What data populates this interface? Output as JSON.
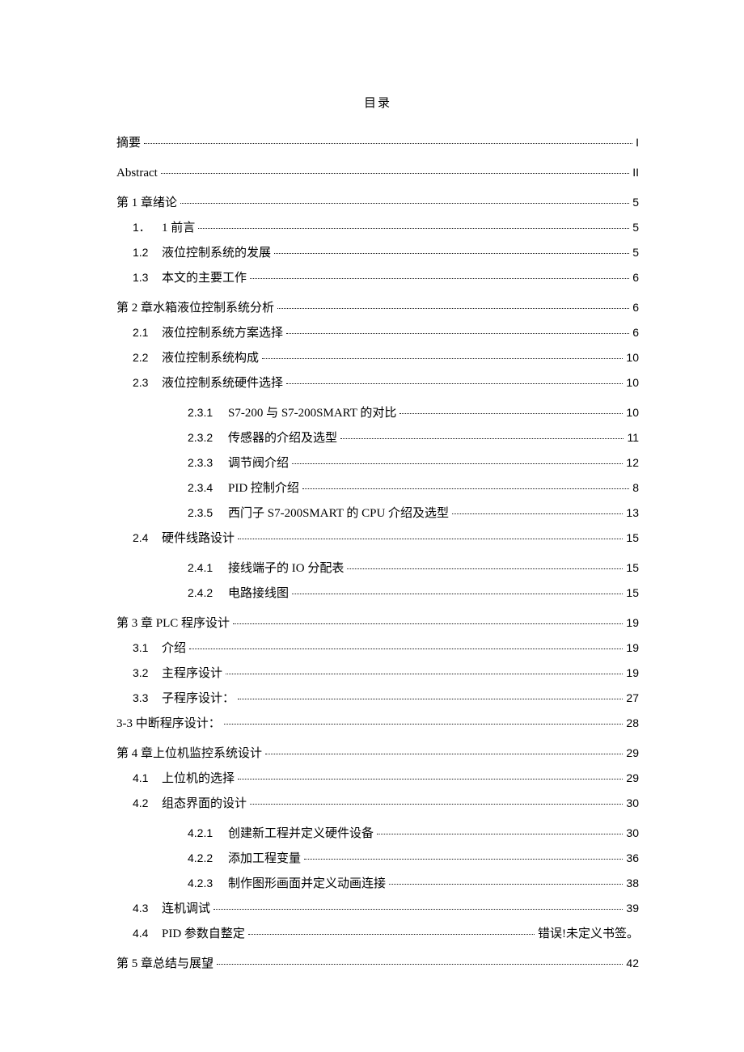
{
  "title": "目录",
  "error_text": "错误!未定义书签。",
  "entries": [
    {
      "level": 0,
      "num": "",
      "text": "摘要",
      "page": "I",
      "spacer": false
    },
    {
      "level": 0,
      "num": "",
      "text": "Abstract",
      "page": "II",
      "spacer": true,
      "font": "latin"
    },
    {
      "level": 0,
      "num": "",
      "text": "第 1 章绪论",
      "page": "5",
      "spacer": true
    },
    {
      "level": 1,
      "num": "1．",
      "text": "1 前言",
      "page": "5",
      "spacer": false
    },
    {
      "level": 1,
      "num": "1.2",
      "text": "液位控制系统的发展",
      "page": "5",
      "spacer": false
    },
    {
      "level": 1,
      "num": "1.3",
      "text": "本文的主要工作",
      "page": "6",
      "spacer": false
    },
    {
      "level": 0,
      "num": "",
      "text": "第 2 章水箱液位控制系统分析",
      "page": "6",
      "spacer": true
    },
    {
      "level": 1,
      "num": "2.1",
      "text": "液位控制系统方案选择",
      "page": "6",
      "spacer": false
    },
    {
      "level": 1,
      "num": "2.2",
      "text": "液位控制系统构成",
      "page": "10",
      "spacer": false
    },
    {
      "level": 1,
      "num": "2.3",
      "text": "液位控制系统硬件选择",
      "page": "10",
      "spacer": false
    },
    {
      "level": 2,
      "num": "2.3.1",
      "text": "S7-200 与 S7-200SMART 的对比",
      "page": "10",
      "spacer": true
    },
    {
      "level": 2,
      "num": "2.3.2",
      "text": "传感器的介绍及选型",
      "page": "11",
      "spacer": false
    },
    {
      "level": 2,
      "num": "2.3.3",
      "text": "调节阀介绍",
      "page": "12",
      "spacer": false
    },
    {
      "level": 2,
      "num": "2.3.4",
      "text": "PID 控制介绍",
      "page": "8",
      "spacer": false
    },
    {
      "level": 2,
      "num": "2.3.5",
      "text": "西门子 S7-200SMART 的 CPU 介绍及选型",
      "page": "13",
      "spacer": false
    },
    {
      "level": 1,
      "num": "2.4",
      "text": "硬件线路设计",
      "page": "15",
      "spacer": false
    },
    {
      "level": 2,
      "num": "2.4.1",
      "text": "接线端子的 IO 分配表",
      "page": "15",
      "spacer": true
    },
    {
      "level": 2,
      "num": "2.4.2",
      "text": "电路接线图",
      "page": "15",
      "spacer": false
    },
    {
      "level": 0,
      "num": "",
      "text": "第 3 章 PLC 程序设计",
      "page": "19",
      "spacer": true
    },
    {
      "level": 1,
      "num": "3.1",
      "text": "介绍",
      "page": "19",
      "spacer": false
    },
    {
      "level": 1,
      "num": "3.2",
      "text": "主程序设计",
      "page": "19",
      "spacer": false
    },
    {
      "level": 1,
      "num": "3.3",
      "text": "子程序设计：",
      "page": "27",
      "spacer": false
    },
    {
      "level": 1,
      "num": "",
      "text": "3-3 中断程序设计：",
      "page": "28",
      "spacer": false,
      "flush": true
    },
    {
      "level": 0,
      "num": "",
      "text": "第 4 章上位机监控系统设计",
      "page": "29",
      "spacer": true
    },
    {
      "level": 1,
      "num": "4.1",
      "text": "上位机的选择",
      "page": "29",
      "spacer": false
    },
    {
      "level": 1,
      "num": "4.2",
      "text": "组态界面的设计",
      "page": "30",
      "spacer": false
    },
    {
      "level": 2,
      "num": "4.2.1",
      "text": "创建新工程并定义硬件设备",
      "page": "30",
      "spacer": true
    },
    {
      "level": 2,
      "num": "4.2.2",
      "text": "添加工程变量",
      "page": "36",
      "spacer": false
    },
    {
      "level": 2,
      "num": "4.2.3",
      "text": "制作图形画面并定义动画连接",
      "page": "38",
      "spacer": false
    },
    {
      "level": 1,
      "num": "4.3",
      "text": "连机调试",
      "page": "39",
      "spacer": false
    },
    {
      "level": 1,
      "num": "4.4",
      "text": "PID 参数自整定",
      "page": "ERROR",
      "spacer": false
    },
    {
      "level": 0,
      "num": "",
      "text": "第 5 章总结与展望",
      "page": "42",
      "spacer": true
    }
  ]
}
